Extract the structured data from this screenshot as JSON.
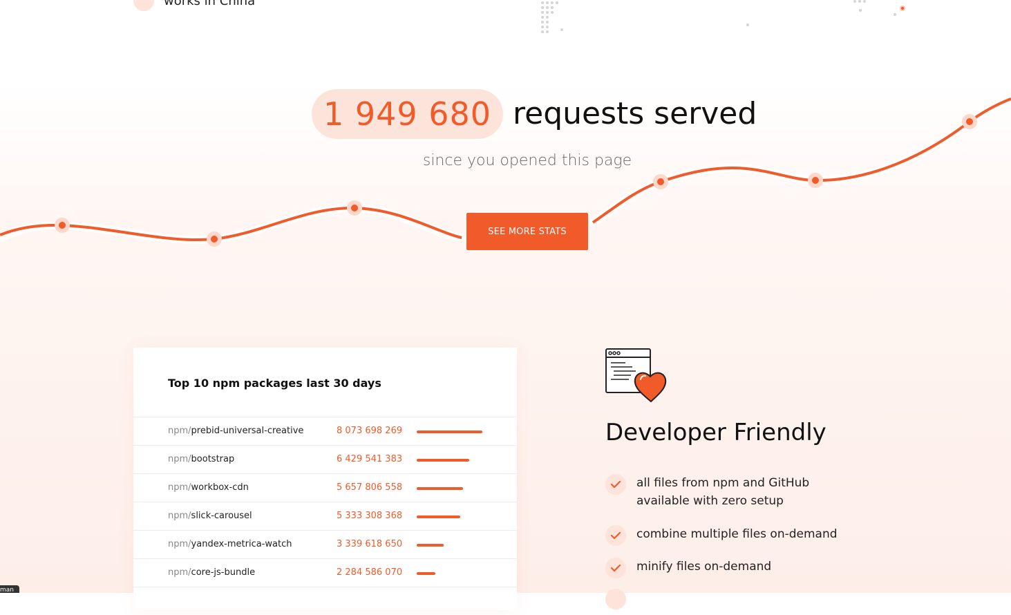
{
  "top_partial": {
    "label": "works in China"
  },
  "counter": {
    "value": "1 949 680",
    "label": "requests served",
    "subtitle": "since you opened this page"
  },
  "stats_button": {
    "label": "SEE MORE STATS"
  },
  "top_packages": {
    "title": "Top 10 npm packages last 30 days",
    "prefix": "npm/",
    "rows": [
      {
        "name": "prebid-universal-creative",
        "count": "8 073 698 269",
        "value": 8073698269
      },
      {
        "name": "bootstrap",
        "count": "6 429 541 383",
        "value": 6429541383
      },
      {
        "name": "workbox-cdn",
        "count": "5 657 806 558",
        "value": 5657806558
      },
      {
        "name": "slick-carousel",
        "count": "5 333 308 368",
        "value": 5333308368
      },
      {
        "name": "yandex-metrica-watch",
        "count": "3 339 618 650",
        "value": 3339618650
      },
      {
        "name": "core-js-bundle",
        "count": "2 284 586 070",
        "value": 2284586070
      }
    ]
  },
  "developer": {
    "icon": "browser-heart-icon",
    "title": "Developer Friendly",
    "features": [
      "all files from npm and GitHub available with zero setup",
      "combine multiple files on-demand",
      "minify files on-demand"
    ]
  },
  "corner_badge": {
    "label": "man"
  },
  "colors": {
    "accent": "#f15a29",
    "accent_light": "#fde4db"
  }
}
